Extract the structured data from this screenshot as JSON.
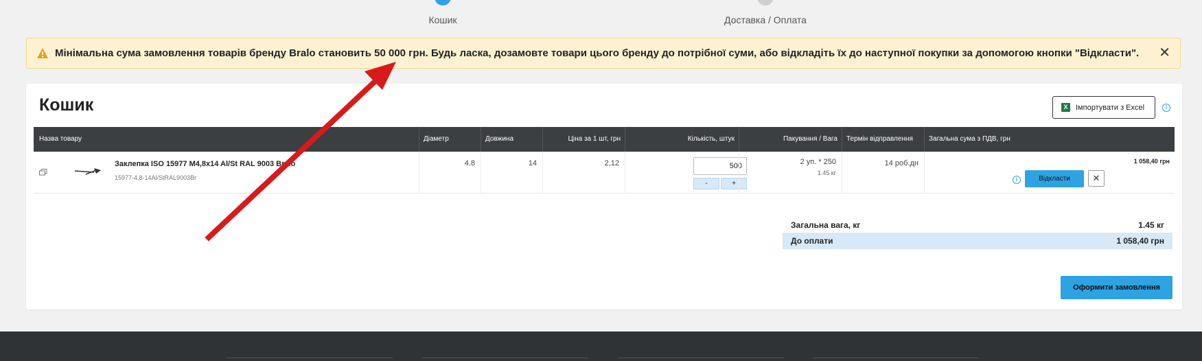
{
  "steps": [
    {
      "label": "Кошик"
    },
    {
      "label": "Доставка / Оплата"
    }
  ],
  "alert": {
    "text": "Мінімальна сума замовлення товарів бренду Bralo становить 50 000 грн. Будь ласка, дозамовте товари цього бренду до потрібної суми, або відкладіть їх до наступної покупки за допомогою кнопки \"Відкласти\".",
    "close": "✕"
  },
  "cart": {
    "title": "Кошик",
    "import_label": "Імпортувати з Excel",
    "columns": [
      "Назва товару",
      "Діаметр",
      "Довжина",
      "Ціна за 1 шт, грн",
      "Кількість, штук",
      "Пакування / Вага",
      "Термін відправлення",
      "Загальна сума з ПДВ, грн"
    ],
    "items": [
      {
        "name": "Заклепка ISO 15977 M4,8x14 Al/St RAL 9003 Bralo",
        "code": "15977-4,8-14Al/StRAL9003Br",
        "diameter": "4.8",
        "length": "14",
        "price": "2,12",
        "quantity": "500",
        "minus": "-",
        "plus": "+",
        "packaging": "2 уп. * 250",
        "weight": "1.45 кг",
        "shipping": "14 роб.дн",
        "total": "1 058,40 грн",
        "defer_label": "Відкласти",
        "remove_label": "✕"
      }
    ]
  },
  "summary": {
    "weight_label": "Загальна вага, кг",
    "weight_value": "1.45 кг",
    "pay_label": "До оплати",
    "pay_value": "1 058,40 грн"
  },
  "checkout_label": "Оформити замовлення",
  "colors": {
    "accent": "#2ea3e3",
    "alert_bg": "#fcf2d2",
    "header_bg": "#3b3f42",
    "annotation_arrow": "#d81a1a"
  }
}
